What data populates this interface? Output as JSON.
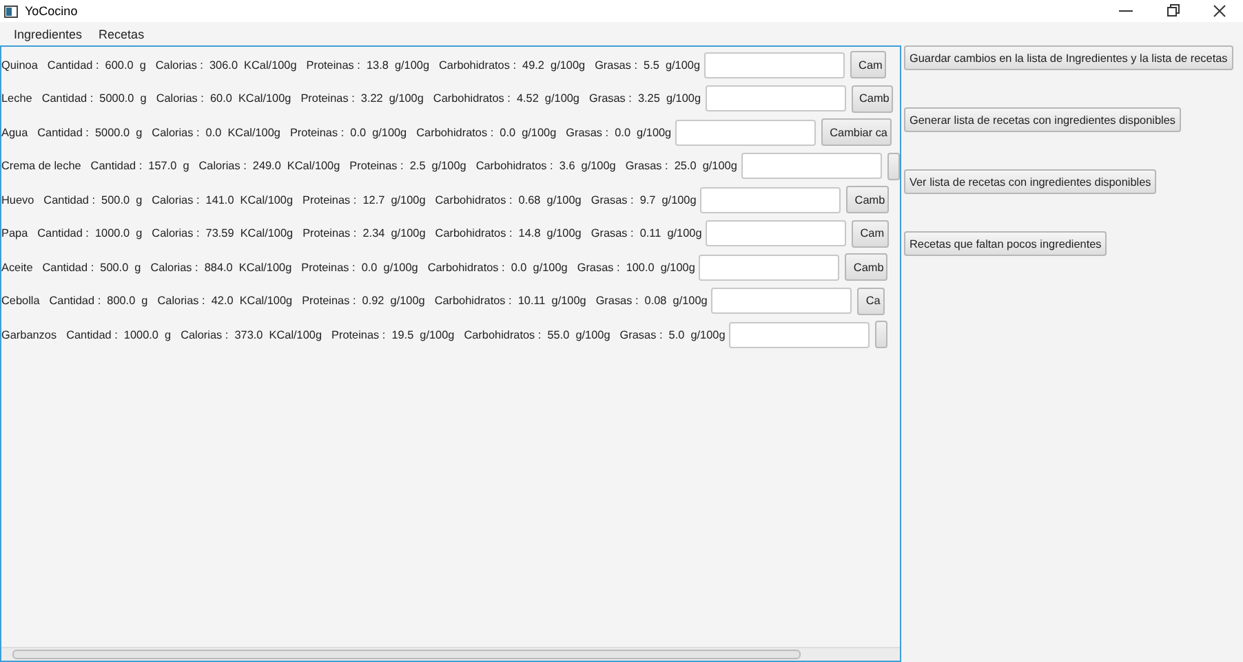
{
  "window": {
    "title": "YoCocino"
  },
  "menu": [
    "Ingredientes",
    "Recetas"
  ],
  "ingredients": [
    {
      "name": "Quinoa",
      "fields": [
        "Cantidad :  600.0  g",
        "Calorias :  306.0  KCal/100g",
        "Proteinas :  13.8  g/100g",
        "Carbohidratos :  49.2  g/100g",
        "Grasas :  5.5  g/100g"
      ],
      "button": "Cam"
    },
    {
      "name": "Leche",
      "fields": [
        "Cantidad :  5000.0  g",
        "Calorias :  60.0  KCal/100g",
        "Proteinas :  3.22  g/100g",
        "Carbohidratos :  4.52  g/100g",
        "Grasas :  3.25  g/100g"
      ],
      "button": "Camb"
    },
    {
      "name": "Agua",
      "fields": [
        "Cantidad :  5000.0  g",
        "Calorias :  0.0  KCal/100g",
        "Proteinas :  0.0  g/100g",
        "Carbohidratos :  0.0  g/100g",
        "Grasas :  0.0  g/100g"
      ],
      "button": "Cambiar ca"
    },
    {
      "name": "Crema de leche",
      "fields": [
        "Cantidad :  157.0  g",
        "Calorias :  249.0  KCal/100g",
        "Proteinas :  2.5  g/100g",
        "Carbohidratos :  3.6  g/100g",
        "Grasas :  25.0  g/100g"
      ]
    },
    {
      "name": "Huevo",
      "fields": [
        "Cantidad :  500.0  g",
        "Calorias :  141.0  KCal/100g",
        "Proteinas :  12.7  g/100g",
        "Carbohidratos :  0.68  g/100g",
        "Grasas :  9.7  g/100g"
      ],
      "button": "Camb"
    },
    {
      "name": "Papa",
      "fields": [
        "Cantidad :  1000.0  g",
        "Calorias :  73.59  KCal/100g",
        "Proteinas :  2.34  g/100g",
        "Carbohidratos :  14.8  g/100g",
        "Grasas :  0.11  g/100g"
      ],
      "button": "Cam"
    },
    {
      "name": "Aceite",
      "fields": [
        "Cantidad :  500.0  g",
        "Calorias :  884.0  KCal/100g",
        "Proteinas :  0.0  g/100g",
        "Carbohidratos :  0.0  g/100g",
        "Grasas :  100.0  g/100g"
      ],
      "button": "Camb"
    },
    {
      "name": "Cebolla",
      "fields": [
        "Cantidad :  800.0  g",
        "Calorias :  42.0  KCal/100g",
        "Proteinas :  0.92  g/100g",
        "Carbohidratos :  10.11  g/100g",
        "Grasas :  0.08  g/100g"
      ],
      "button": "Ca"
    },
    {
      "name": "Garbanzos",
      "fields": [
        "Cantidad :  1000.0  g",
        "Calorias :  373.0  KCal/100g",
        "Proteinas :  19.5  g/100g",
        "Carbohidratos :  55.0  g/100g",
        "Grasas :  5.0  g/100g"
      ]
    }
  ],
  "actions": [
    "Guardar cambios en la lista de Ingredientes y la lista de recetas",
    "Generar lista de recetas con ingredientes disponibles",
    "Ver lista de recetas con ingredientes disponibles",
    "Recetas que faltan pocos ingredientes"
  ]
}
